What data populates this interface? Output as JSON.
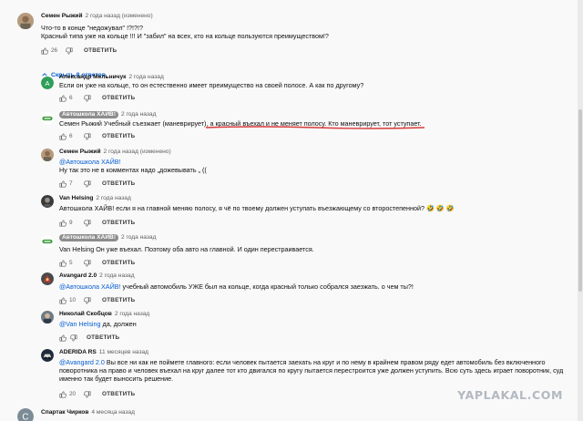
{
  "colors": {
    "link": "#065fd4",
    "chip": "#8d8d8d",
    "underline": "#d93a3a",
    "school_logo": "#3d9b3d"
  },
  "reply_label": "ОТВЕТИТЬ",
  "show_replies": "Скрыть 8 ответов",
  "watermark": "YAPLAKAL.COM",
  "comments": [
    {
      "author": "Семен Рыжий",
      "meta": "2 года назад (изменено)",
      "lines": [
        "Что-то в конце \"недожувал\" !?!?!?",
        "Красный типа уже на кольце !!! И \"забил\" на всех, кто на кольце пользуются преимуществом!?"
      ],
      "likes": "26",
      "avatar": "photo-icon"
    },
    {
      "author": "Александр Мельничук",
      "meta": "2 года назад",
      "lines": [
        "Если он уже на кольце, то он естественно имеет преимущество на своей полосе. А как по другому?"
      ],
      "likes": "6",
      "avatar": "letter-a-icon",
      "avatar_letter": "A",
      "avatar_color": "#2e9e58"
    },
    {
      "author": "Автошкола ХАЙВ!",
      "meta": "2 года назад",
      "lines": [
        "Семен Рыжий Учебный съезжает (маневрирует), а красный въехал и не меняет полосу. Кто маневрирует, тот уступает."
      ],
      "likes": "6",
      "avatar": "school-logo-icon"
    },
    {
      "author": "Семен Рыжий",
      "meta": "2 года назад (изменено)",
      "mention": "@Автошкола ХАЙВ!",
      "lines": [
        "Ну так это не в комментах надо „дожевывать „ (("
      ],
      "likes": "7",
      "avatar": "photo-icon"
    },
    {
      "author": "Van Helsing",
      "meta": "2 года назад",
      "lines": [
        "Автошкола ХАЙВ! если я на главной меняю полосу, я чё по твоему должен уступать въезжающему со второстепенной? 🤣 🤣 🤣"
      ],
      "likes": "9",
      "avatar": "helsing-avatar-icon"
    },
    {
      "author": "Автошкола ХАЙВ!",
      "meta": "2 года назад",
      "lines": [
        "Van Helsing Он уже въехал. Поэтому оба авто на главной. И один перестраивается."
      ],
      "likes": "5",
      "avatar": "school-logo-icon"
    },
    {
      "author": "Avangard 2.0",
      "meta": "2 года назад",
      "mention": "@Автошкола ХАЙВ!",
      "lines": [
        " учебный автомобиль УЖЕ был на кольце, когда красный  только собрался заезжать. о чем ты?!"
      ],
      "likes": "10",
      "avatar": "avangard-avatar-icon"
    },
    {
      "author": "Николай Скобцов",
      "meta": "2 года назад",
      "mention": "@Van Helsing",
      "lines": [
        " да, должен"
      ],
      "likes": "",
      "avatar": "nikolay-avatar-icon"
    },
    {
      "author": "ADERIDA RS",
      "meta": "11 месяцев назад",
      "mention": "@Avangard 2.0",
      "lines": [
        " Вы все ни как не поймете главного: если человек пытается заехать на круг и по нему в крайнем правом ряду едет автомобиль без включенного",
        "поворотника на право и человек въехал на круг далее тот кто двигался по кругу пытается перестроится уже должен уступить. Всю суть здесь играет поворотник, суд",
        "именно так будет выносить решение."
      ],
      "likes": "20",
      "avatar": "aderida-avatar-icon"
    },
    {
      "author": "Спартак Чирков",
      "meta": "4 месяца назад",
      "lines": [],
      "likes": "",
      "avatar": "letter-c-icon",
      "avatar_letter": "С",
      "avatar_color": "#7b8c97"
    }
  ]
}
